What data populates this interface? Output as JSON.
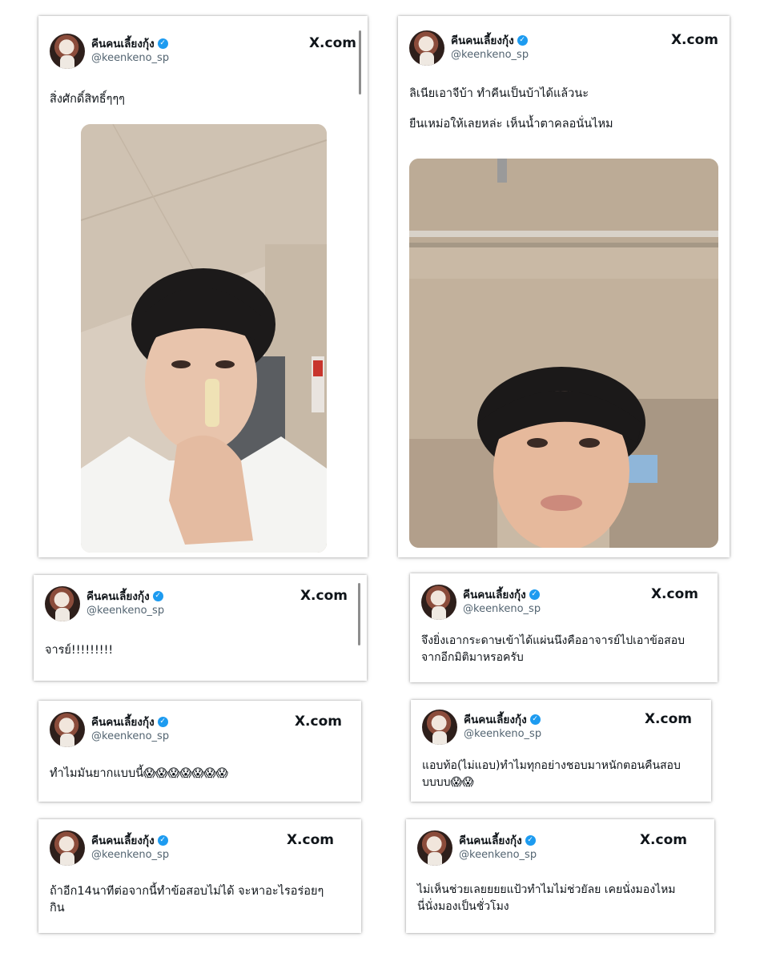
{
  "tweets": [
    {
      "name": "คีนคนเลี้ยงกุ้ง",
      "handle": "@keenkeno_sp",
      "site": "X.com",
      "lines": [
        "สิ่งศักดิ์สิทธิ์ๆๆๆ"
      ],
      "photo": "selfie-holding-lip-balm"
    },
    {
      "name": "คีนคนเลี้ยงกุ้ง",
      "handle": "@keenkeno_sp",
      "site": "X.com",
      "lines": [
        "ลิเนียเอาจีบ้า ทำคีนเป็นบ้าได้แล้วนะ",
        "ยืนเหม่อให้เลยหล่ะ เห็นน้ำตาคลอนั่นไหม"
      ],
      "photo": "selfie-looking-up-stairwell"
    },
    {
      "name": "คีนคนเลี้ยงกุ้ง",
      "handle": "@keenkeno_sp",
      "site": "X.com",
      "lines": [
        "จารย์!!!!!!!!!"
      ]
    },
    {
      "name": "คีนคนเลี้ยงกุ้ง",
      "handle": "@keenkeno_sp",
      "site": "X.com",
      "lines": [
        "จึงยิ่งเอากระดาษเข้าได้แผ่นนึงคืออาจารย์ไปเอาข้อสอบ",
        "จากอีกมิติมาหรอครับ"
      ]
    },
    {
      "name": "คีนคนเลี้ยงกุ้ง",
      "handle": "@keenkeno_sp",
      "site": "X.com",
      "lines": [
        "ทำไมมันยากแบบนี้😱😱😱😱😱😱😱"
      ]
    },
    {
      "name": "คีนคนเลี้ยงกุ้ง",
      "handle": "@keenkeno_sp",
      "site": "X.com",
      "lines": [
        "แอบท้อ(ไม่แอบ)ทำไมทุกอย่างชอบมาหนักตอนคืนสอบ",
        "บบบบ😱😱"
      ]
    },
    {
      "name": "คีนคนเลี้ยงกุ้ง",
      "handle": "@keenkeno_sp",
      "site": "X.com",
      "lines": [
        "ถ้าอีก14นาทีต่อจากนี้ทำข้อสอบไม่ได้ จะหาอะไรอร่อยๆ",
        "กิน"
      ]
    },
    {
      "name": "คีนคนเลี้ยงกุ้ง",
      "handle": "@keenkeno_sp",
      "site": "X.com",
      "lines": [
        "ไม่เห็นช่วยเลยยยยแป้วทำไมไม่ช่วยัลย เคยนั่งมองไหม",
        "นี่นั่งมองเป็นชั่วโมง"
      ]
    }
  ]
}
